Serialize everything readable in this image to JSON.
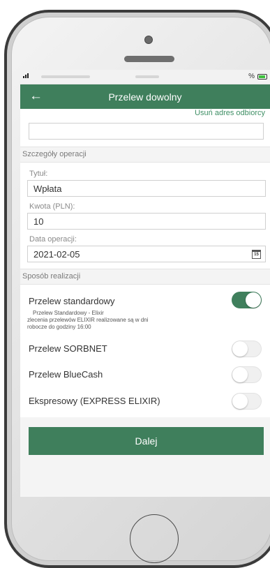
{
  "status_bar": {
    "battery_text": "%"
  },
  "header": {
    "title": "Przelew dowolny",
    "back_icon": "arrow-left-icon"
  },
  "recipient": {
    "remove_link": "Usuń adres odbiorcy"
  },
  "operation_details": {
    "section_title": "Szczegóły operacji",
    "title_label": "Tytuł:",
    "title_value": "Wpłata",
    "amount_label": "Kwota (PLN):",
    "amount_value": "10",
    "date_label": "Data operacji:",
    "date_value": "2021-02-05",
    "calendar_day": "15"
  },
  "realization": {
    "section_title": "Sposób realizacji",
    "options": [
      {
        "label": "Przelew standardowy",
        "enabled": true,
        "desc_line1": "Przelew Standardowy - Elixir",
        "desc_line2": "zlecenia przelewów ELIXIR realizowane są w dni",
        "desc_line3": "robocze do godziny 16:00"
      },
      {
        "label": "Przelew SORBNET",
        "enabled": false
      },
      {
        "label": "Przelew BlueCash",
        "enabled": false
      },
      {
        "label": "Ekspresowy (EXPRESS ELIXIR)",
        "enabled": false
      }
    ]
  },
  "actions": {
    "next_label": "Dalej"
  },
  "colors": {
    "accent": "#3f7f5c",
    "link": "#3f8f65"
  }
}
